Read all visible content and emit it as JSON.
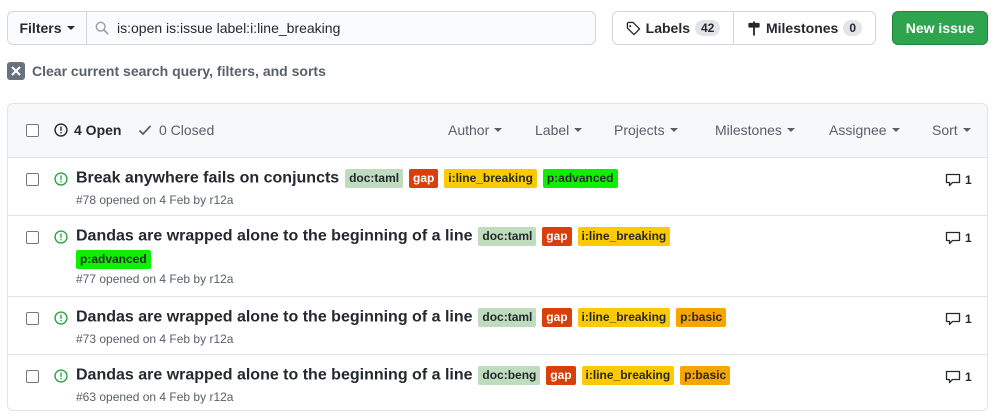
{
  "toolbar": {
    "filters_label": "Filters",
    "search_value": "is:open is:issue label:i:line_breaking",
    "labels_label": "Labels",
    "labels_count": "42",
    "milestones_label": "Milestones",
    "milestones_count": "0",
    "new_issue_label": "New issue"
  },
  "clear_filters_label": "Clear current search query, filters, and sorts",
  "list_header": {
    "open_label": "4 Open",
    "closed_label": "0 Closed",
    "menus": [
      "Author",
      "Label",
      "Projects",
      "Milestones",
      "Assignee",
      "Sort"
    ]
  },
  "colors": {
    "open_icon": "#28a745",
    "primary_button": "#2ea44f",
    "label_doc": "#bfdcbf",
    "label_gap": "#d93f0b",
    "label_line_breaking": "#fbca04",
    "label_advanced": "#0ff000",
    "label_basic": "#f9a500"
  },
  "issues": [
    {
      "title": "Break anywhere fails on conjuncts",
      "labels": [
        {
          "text": "doc:taml",
          "bg": "#bfdcbf",
          "fg": "#24292e"
        },
        {
          "text": "gap",
          "bg": "#d93f0b",
          "fg": "#ffffff"
        },
        {
          "text": "i:line_breaking",
          "bg": "#fbca04",
          "fg": "#24292e"
        },
        {
          "text": "p:advanced",
          "bg": "#0ff000",
          "fg": "#24292e"
        }
      ],
      "meta": "#78 opened on 4 Feb by r12a",
      "comments": "1"
    },
    {
      "title": "Dandas are wrapped alone to the beginning of a line",
      "labels": [
        {
          "text": "doc:taml",
          "bg": "#bfdcbf",
          "fg": "#24292e"
        },
        {
          "text": "gap",
          "bg": "#d93f0b",
          "fg": "#ffffff"
        },
        {
          "text": "i:line_breaking",
          "bg": "#fbca04",
          "fg": "#24292e"
        },
        {
          "text": "p:advanced",
          "bg": "#0ff000",
          "fg": "#24292e"
        }
      ],
      "meta": "#77 opened on 4 Feb by r12a",
      "comments": "1"
    },
    {
      "title": "Dandas are wrapped alone to the beginning of a line",
      "labels": [
        {
          "text": "doc:taml",
          "bg": "#bfdcbf",
          "fg": "#24292e"
        },
        {
          "text": "gap",
          "bg": "#d93f0b",
          "fg": "#ffffff"
        },
        {
          "text": "i:line_breaking",
          "bg": "#fbca04",
          "fg": "#24292e"
        },
        {
          "text": "p:basic",
          "bg": "#f9a500",
          "fg": "#24292e"
        }
      ],
      "meta": "#73 opened on 4 Feb by r12a",
      "comments": "1"
    },
    {
      "title": "Dandas are wrapped alone to the beginning of a line",
      "labels": [
        {
          "text": "doc:beng",
          "bg": "#bfdcbf",
          "fg": "#24292e"
        },
        {
          "text": "gap",
          "bg": "#d93f0b",
          "fg": "#ffffff"
        },
        {
          "text": "i:line_breaking",
          "bg": "#fbca04",
          "fg": "#24292e"
        },
        {
          "text": "p:basic",
          "bg": "#f9a500",
          "fg": "#24292e"
        }
      ],
      "meta": "#63 opened on 4 Feb by r12a",
      "comments": "1"
    }
  ]
}
